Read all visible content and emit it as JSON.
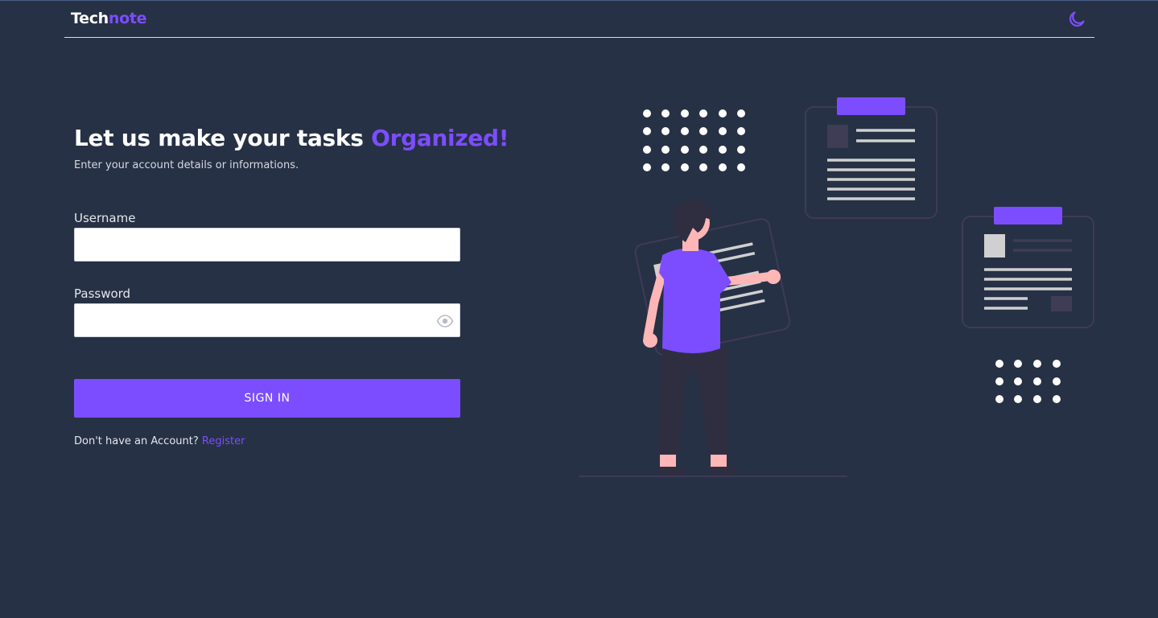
{
  "navbar": {
    "brand_part1": "Tech",
    "brand_part2": "note",
    "theme_icon": "moon-icon"
  },
  "login": {
    "heading_main": "Let us make your tasks ",
    "heading_accent": "Organized!",
    "subtitle": "Enter your account details or informations.",
    "username_label": "Username",
    "username_value": "",
    "password_label": "Password",
    "password_value": "",
    "password_toggle_icon": "eye-icon",
    "signin_label": "SIGN IN",
    "no_account_text": "Don't have an Account?",
    "register_link": "Register"
  },
  "colors": {
    "background": "#263145",
    "accent": "#7c4dff",
    "input_background": "#ffffff",
    "text": "#ffffff"
  },
  "illustration": {
    "name": "person-organizing-documents-illustration"
  }
}
